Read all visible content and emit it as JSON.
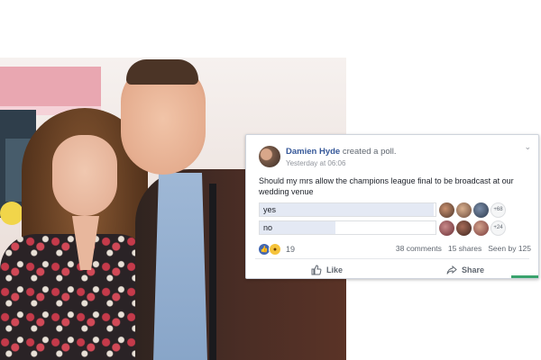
{
  "post": {
    "author": "Damien Hyde",
    "action": "created a poll.",
    "timestamp": "Yesterday at 06:06",
    "text": "Should my mrs allow the champions league final to be broadcast at our wedding venue"
  },
  "poll": {
    "options": [
      {
        "label": "yes",
        "fill_fraction": 0.99,
        "more_voters": "+68"
      },
      {
        "label": "no",
        "fill_fraction": 0.43,
        "more_voters": "+24"
      }
    ]
  },
  "reactions": {
    "count": "19"
  },
  "stats": {
    "comments": "38 comments",
    "shares": "15 shares",
    "seen": "Seen by 125"
  },
  "actions": {
    "like": "Like",
    "share": "Share"
  },
  "icons": {
    "header_menu": "chevron-down-icon",
    "like_reaction": "thumbs-up-icon",
    "wow_reaction": "wow-face-icon",
    "like_button": "thumbs-up-outline-icon",
    "share_button": "share-arrow-icon"
  },
  "colors": {
    "name_link": "#365899",
    "like_blue": "#4267b2",
    "poll_fill": "#e4e9f4"
  }
}
